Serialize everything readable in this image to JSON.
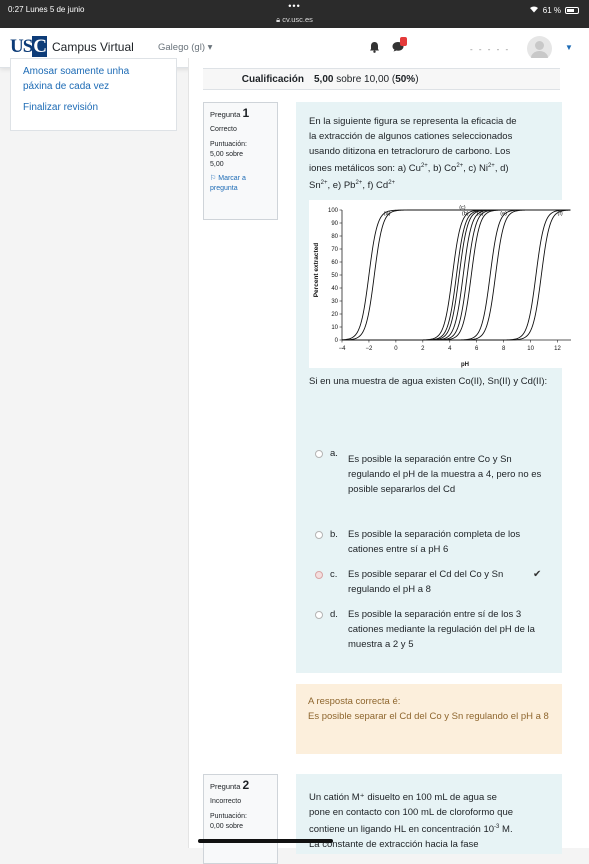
{
  "status_bar": {
    "time_date": "0:27  Lunes 5 de junio",
    "url": "cv.usc.es",
    "battery": "61 %"
  },
  "navbar": {
    "logo": "USC",
    "brand": "Campus Virtual",
    "language": "Galego (gl) ▾"
  },
  "sidebar": {
    "show_one_page": "Amosar soamente unha páxina de cada vez",
    "finish_review": "Finalizar revisión"
  },
  "summary": {
    "label": "Cualificación",
    "score": "5,00",
    "score_rest": " sobre 10,00 (",
    "percent": "50%",
    "close": ")"
  },
  "question1": {
    "label": "Pregunta",
    "number": "1",
    "state": "Correcto",
    "mark_label": "Puntuación:",
    "mark_value": "5,00 sobre 5,00",
    "flag": "Marcar a pregunta",
    "text_line1": "En la siguiente figura se representa la eficacia de",
    "text_line2": "la extracción de algunos cationes seleccionados",
    "text_line3": "usando ditizona en tetracloruro de carbono. Los",
    "text_line4_pre": "iones metálicos son: a) Cu",
    "text_line4_mid1": ", b) Co",
    "text_line4_mid2": ", c) Ni",
    "text_line4_post": ", d)",
    "text_line5_pre": "Sn",
    "text_line5_mid1": ", e) Pb",
    "text_line5_mid2": ", f) Cd",
    "charge": "2+",
    "prompt": "Si en una  muestra de agua existen Co(II), Sn(II) y Cd(II):",
    "options": [
      {
        "letter": "a.",
        "text": "Es posible la separación entre Co y Sn regulando el pH de la muestra a 4, pero no es posible separarlos del Cd"
      },
      {
        "letter": "b.",
        "text": "Es posible la separación completa de los cationes entre sí a pH 6"
      },
      {
        "letter": "c.",
        "text": "Es posible  separar el Cd del Co y Sn regulando el pH a 8",
        "selected": true,
        "correct": true
      },
      {
        "letter": "d.",
        "text": "Es posible la separación entre sí de los 3 cationes mediante la regulación del pH de la muestra a 2 y  5"
      }
    ],
    "feedback_title": "A resposta correcta é:",
    "feedback_text": "Es posible  separar el Cd del Co y Sn regulando el pH a 8"
  },
  "question2": {
    "label": "Pregunta",
    "number": "2",
    "state": "Incorrecto",
    "mark_label": "Puntuación:",
    "mark_value": "0,00 sobre",
    "text_line1": "Un catión M⁺ disuelto en 100 mL de agua se",
    "text_line2": "pone en contacto con 100 mL de cloroformo que",
    "text_line3_pre": "contiene un ligando HL en concentración 10",
    "text_line3_exp": "-3",
    "text_line3_post": " M.",
    "text_line4": "La constante de extracción hacia la fase"
  },
  "chart_data": {
    "type": "line",
    "xlabel": "pH",
    "ylabel": "Percent extracted",
    "xlim": [
      -4,
      13
    ],
    "ylim": [
      0,
      100
    ],
    "x_ticks": [
      "−4",
      "−2",
      "0",
      "2",
      "4",
      "6",
      "8",
      "10",
      "12"
    ],
    "y_ticks": [
      "0",
      "10",
      "20",
      "30",
      "40",
      "50",
      "60",
      "70",
      "80",
      "90",
      "100"
    ],
    "series": [
      {
        "name": "(a)",
        "midpoints": [
          -2.0,
          -1.6
        ]
      },
      {
        "name": "(b)",
        "midpoints": [
          4.2,
          4.5
        ]
      },
      {
        "name": "(c)",
        "midpoints": [
          4.7,
          5.0
        ]
      },
      {
        "name": "(d)",
        "midpoints": [
          5.3,
          5.6
        ]
      },
      {
        "name": "(e)",
        "midpoints": [
          7.0,
          7.4
        ]
      },
      {
        "name": "(f)",
        "midpoints": [
          10.4,
          10.8
        ]
      }
    ],
    "colors": {
      "line": "#111111"
    }
  }
}
